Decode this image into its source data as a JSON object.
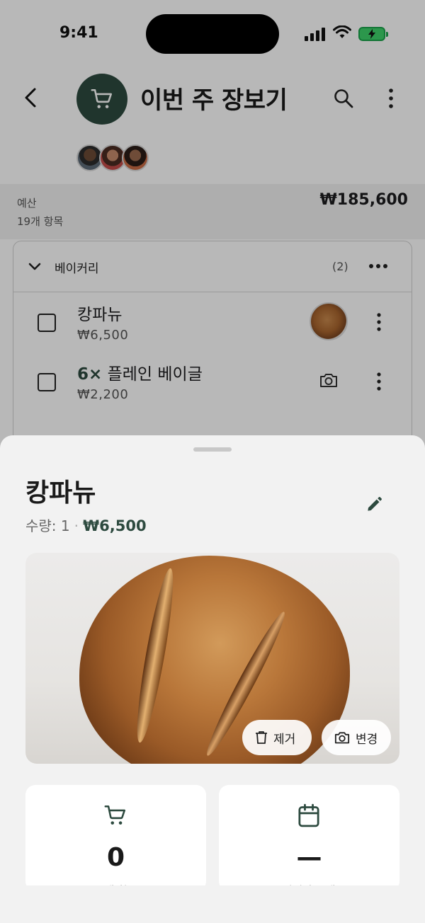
{
  "status_bar": {
    "time": "9:41"
  },
  "header": {
    "title": "이번 주 장보기"
  },
  "budget": {
    "label": "예산",
    "item_count": "19개 항목",
    "amount": "₩185,600"
  },
  "category": {
    "name": "베이커리",
    "count": "(2)",
    "items": [
      {
        "qty_prefix": "",
        "name": "캉파뉴",
        "price": "₩6,500",
        "has_photo": true
      },
      {
        "qty_prefix": "6×",
        "name": " 플레인 베이글",
        "price": "₩2,200",
        "has_photo": false
      }
    ]
  },
  "sheet": {
    "title": "캉파뉴",
    "qty_text": "수량: 1",
    "separator": "·",
    "price": "₩6,500",
    "photo_buttons": {
      "remove": "제거",
      "change": "변경"
    },
    "stats": [
      {
        "icon": "cart-icon",
        "value": "0",
        "label": "구매 횟수"
      },
      {
        "icon": "calendar-icon",
        "value": "—",
        "label": "마지막 구매"
      }
    ]
  },
  "colors": {
    "accent": "#2d4a3f",
    "sheet_bg": "#f2f2f2"
  }
}
